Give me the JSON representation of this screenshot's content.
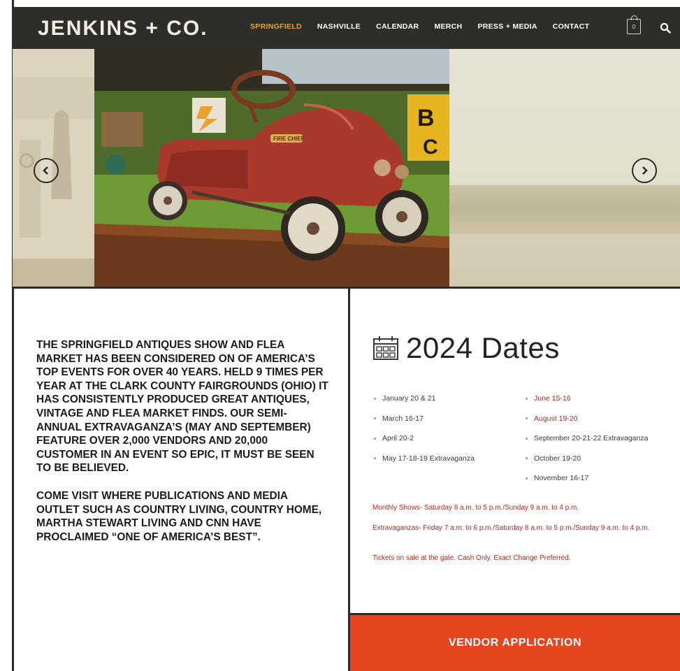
{
  "header": {
    "brand": "JENKINS + CO.",
    "nav": [
      {
        "label": "SPRINGFIELD",
        "active": true
      },
      {
        "label": "NASHVILLE",
        "active": false
      },
      {
        "label": "CALENDAR",
        "active": false
      },
      {
        "label": "MERCH",
        "active": false
      },
      {
        "label": "PRESS + MEDIA",
        "active": false
      },
      {
        "label": "CONTACT",
        "active": false
      }
    ],
    "cart_count": "0",
    "icons": {
      "cart": "shopping-bag-icon",
      "search": "search-icon"
    }
  },
  "carousel": {
    "prev_icon": "chevron-left-icon",
    "next_icon": "chevron-right-icon",
    "pedal_car_badge": "FIRE CHIEF"
  },
  "about": {
    "paragraph1": "THE SPRINGFIELD ANTIQUES SHOW AND FLEA MARKET HAS BEEN CONSIDERED ON OF AMERICA’S TOP EVENTS FOR OVER 40 YEARS. HELD 9 TIMES PER YEAR AT THE CLARK COUNTY FAIRGROUNDS (OHIO) IT HAS CONSISTENTLY PRODUCED GREAT ANTIQUES, VINTAGE AND FLEA MARKET FINDS. OUR SEMI-ANNUAL EXTRAVAGANZA’S (MAY AND SEPTEMBER) FEATURE OVER 2,000 VENDORS AND 20,000 CUSTOMER IN AN EVENT SO EPIC, IT MUST BE SEEN TO BE BELIEVED.",
    "paragraph2": "COME VISIT WHERE PUBLICATIONS AND MEDIA OUTLET SUCH AS COUNTRY LIVING, COUNTRY HOME, MARTHA STEWART LIVING AND CNN HAVE PROCLAIMED “ONE OF AMERICA’S BEST”."
  },
  "dates": {
    "title": "2024 Dates",
    "icon": "calendar-icon",
    "column1": [
      "January 20 & 21",
      "March 16-17",
      "April 20-2",
      "May 17-18-19 Extravaganza"
    ],
    "column2": [
      "June 15-16",
      "August 19-20",
      "September 20-21-22 Extravaganza",
      "October 19-20",
      "November 16-17"
    ],
    "monthly": "Monthly Shows- Saturday 8 a.m. to 5 p.m./Sunday 9 a.m. to 4 p.m.",
    "extravaganzas": "Extravaganzas- Friday 7 a.m. to 6 p.m./Saturday 8 a.m. to 5 p.m./Sunday 9 a.m. to 4 p.m.",
    "tickets": "Tickets on sale at the gate. Cash Only. Exact Change Preferred."
  },
  "cta": {
    "vendor_label": "VENDOR APPLICATION"
  },
  "colors": {
    "header_bg": "#2f2d2a",
    "active_nav": "#e0a32a",
    "accent_red": "#b12a18",
    "cta_orange": "#e5451f"
  }
}
